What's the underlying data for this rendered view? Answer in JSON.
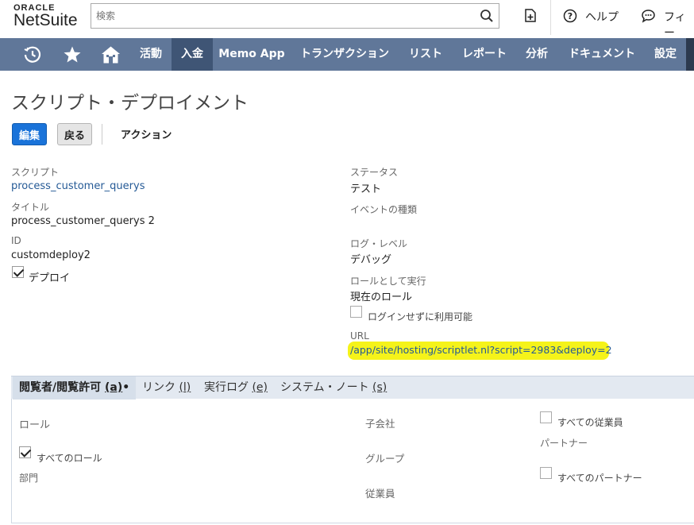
{
  "header": {
    "logo_top": "ORACLE",
    "logo_bottom": "NetSuite",
    "search_placeholder": "検索",
    "help_label": "ヘルプ",
    "feedback_label": "フィー"
  },
  "nav": {
    "items": [
      "活動",
      "入金",
      "Memo App",
      "トランザクション",
      "リスト",
      "レポート",
      "分析",
      "ドキュメント",
      "設定"
    ],
    "active_index": 1,
    "icons": [
      "recent-icon",
      "star-icon",
      "home-icon"
    ]
  },
  "page": {
    "title": "スクリプト・デプロイメント",
    "buttons": {
      "edit": "編集",
      "back": "戻る",
      "actions": "アクション"
    }
  },
  "fields": {
    "script_label": "スクリプト",
    "script_value": "process_customer_querys",
    "title_label": "タイトル",
    "title_value": "process_customer_querys 2",
    "id_label": "ID",
    "id_value": "customdeploy2",
    "deploy_label": "デプロイ",
    "deploy_checked": true,
    "status_label": "ステータス",
    "status_value": "テスト",
    "event_type_label": "イベントの種類",
    "log_level_label": "ログ・レベル",
    "log_level_value": "デバッグ",
    "execute_as_role_label": "ロールとして実行",
    "execute_as_role_value": "現在のロール",
    "available_without_login_label": "ログインせずに利用可能",
    "available_without_login_checked": false,
    "url_label": "URL",
    "url_value": "/app/site/hosting/scriptlet.nl?script=2983&deploy=2",
    "highlight_color": "#f5f31a"
  },
  "tabs": [
    {
      "label": "閲覧者/閲覧許可 ",
      "key": "(a)",
      "suffix": "•"
    },
    {
      "label": "リンク ",
      "key": "(l)",
      "suffix": ""
    },
    {
      "label": "実行ログ ",
      "key": "(e)",
      "suffix": ""
    },
    {
      "label": "システム・ノート ",
      "key": "(s)",
      "suffix": ""
    }
  ],
  "audience": {
    "roles_label": "ロール",
    "all_roles_label": "すべてのロール",
    "all_roles_checked": true,
    "departments_label": "部門",
    "subsidiaries_label": "子会社",
    "groups_label": "グループ",
    "employees_label": "従業員",
    "all_employees_label": "すべての従業員",
    "all_employees_checked": false,
    "partners_label": "パートナー",
    "all_partners_label": "すべてのパートナー",
    "all_partners_checked": false
  },
  "colors": {
    "nav_bg": "#607799",
    "nav_active": "#3f5575",
    "primary_button": "#1a73d9",
    "link": "#255a96"
  }
}
